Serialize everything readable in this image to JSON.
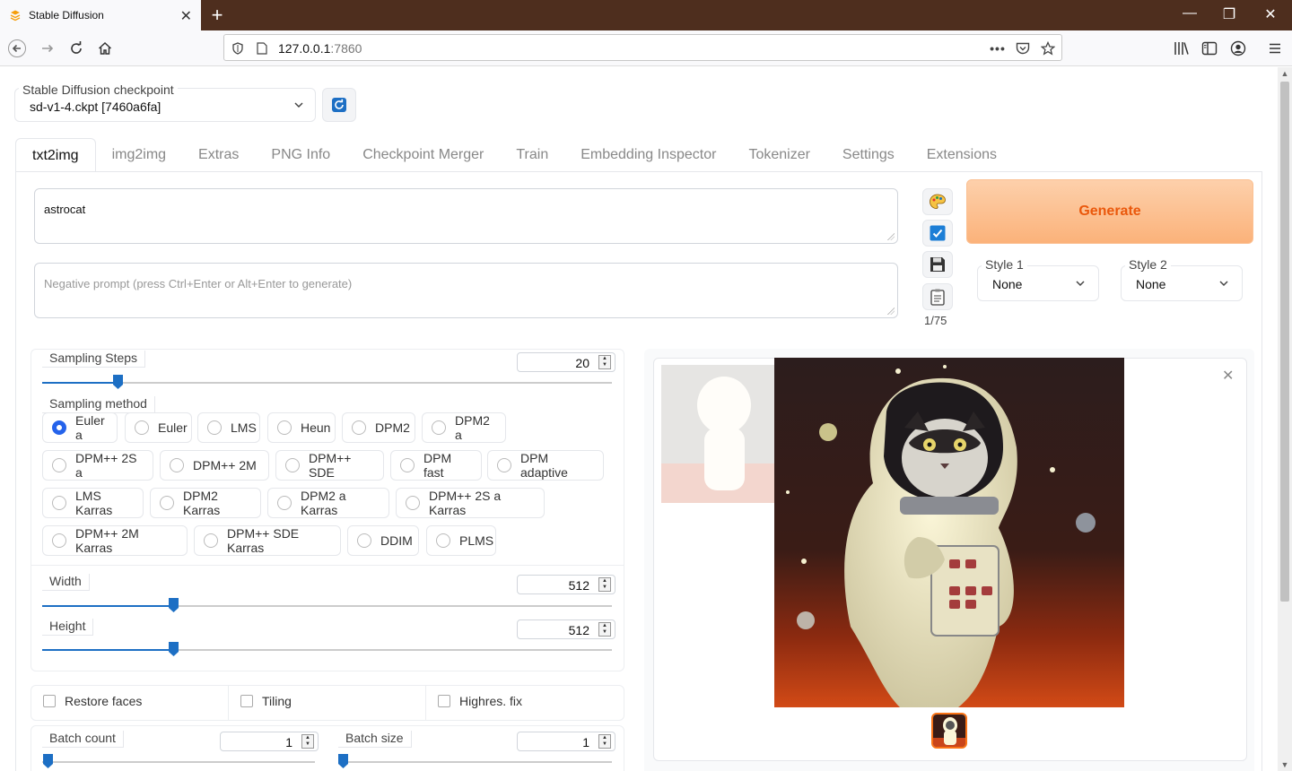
{
  "browser": {
    "tab_title": "Stable Diffusion",
    "url_host": "127.0.0.1",
    "url_port": ":7860"
  },
  "checkpoint": {
    "label": "Stable Diffusion checkpoint",
    "value": "sd-v1-4.ckpt [7460a6fa]"
  },
  "tabs": [
    "txt2img",
    "img2img",
    "Extras",
    "PNG Info",
    "Checkpoint Merger",
    "Train",
    "Embedding Inspector",
    "Tokenizer",
    "Settings",
    "Extensions"
  ],
  "prompt": {
    "value": "astrocat",
    "negative_placeholder": "Negative prompt (press Ctrl+Enter or Alt+Enter to generate)"
  },
  "token_count": "1/75",
  "generate_label": "Generate",
  "styles": [
    {
      "label": "Style 1",
      "value": "None"
    },
    {
      "label": "Style 2",
      "value": "None"
    }
  ],
  "sampling_steps": {
    "label": "Sampling Steps",
    "value": "20"
  },
  "sampling_method": {
    "label": "Sampling method",
    "selected": "Euler a",
    "options": [
      "Euler a",
      "Euler",
      "LMS",
      "Heun",
      "DPM2",
      "DPM2 a",
      "DPM++ 2S a",
      "DPM++ 2M",
      "DPM++ SDE",
      "DPM fast",
      "DPM adaptive",
      "LMS Karras",
      "DPM2 Karras",
      "DPM2 a Karras",
      "DPM++ 2S a Karras",
      "DPM++ 2M Karras",
      "DPM++ SDE Karras",
      "DDIM",
      "PLMS"
    ]
  },
  "width": {
    "label": "Width",
    "value": "512"
  },
  "height": {
    "label": "Height",
    "value": "512"
  },
  "checkboxes": {
    "restore_faces": "Restore faces",
    "tiling": "Tiling",
    "highres_fix": "Highres. fix"
  },
  "batch_count": {
    "label": "Batch count",
    "value": "1"
  },
  "batch_size": {
    "label": "Batch size",
    "value": "1"
  },
  "colors": {
    "accent": "#2563eb",
    "generate_text": "#ea580c",
    "titlebar": "#4e2e1e"
  }
}
